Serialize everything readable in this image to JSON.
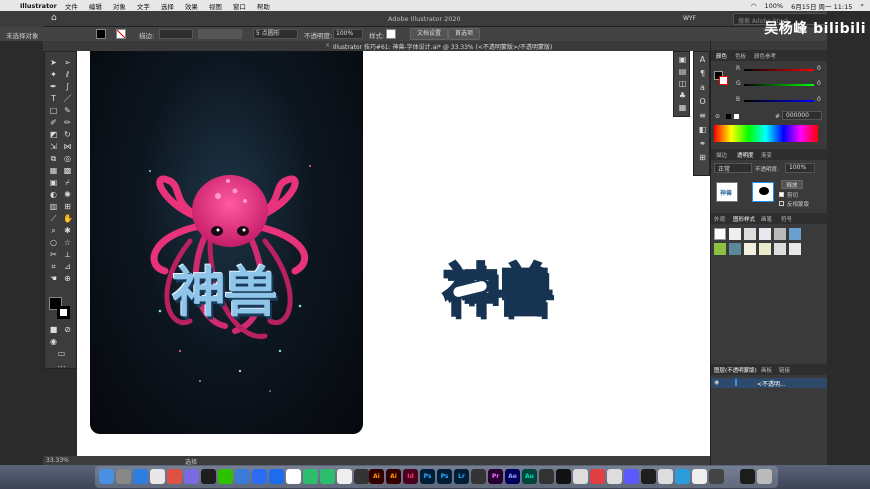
{
  "menubar": {
    "app_name": "Illustrator",
    "items": [
      "文件",
      "编辑",
      "对象",
      "文字",
      "选择",
      "效果",
      "视图",
      "窗口",
      "帮助"
    ],
    "battery": "100%",
    "clock": "6月15日 周一 11:15"
  },
  "appbar": {
    "title": "Adobe Illustrator 2020",
    "workspace": "WYF",
    "stock_placeholder": "搜索 Adobe Stock"
  },
  "controlbar": {
    "selection": "未选择对象",
    "stroke_label": "描边:",
    "brush_size": "5 点圆形",
    "opacity_label": "不透明度:",
    "opacity_value": "100%",
    "style_label": "样式:",
    "doc_setup": "文档设置",
    "preferences": "首选项"
  },
  "document": {
    "tab_title": "Illustrator 技巧#61: 神兽-字体设计.ai* @ 33.33% (<不透明蒙版>/不透明蒙版)"
  },
  "canvas": {
    "artwork_text": "神兽",
    "right_text": "神兽"
  },
  "statusbar": {
    "zoom": "33.33%",
    "tool": "选择"
  },
  "panels": {
    "color_tabs": [
      "颜色",
      "色板",
      "颜色参考"
    ],
    "channels": [
      {
        "label": "R",
        "value": "0"
      },
      {
        "label": "G",
        "value": "0"
      },
      {
        "label": "B",
        "value": "0"
      }
    ],
    "hex": "000000",
    "transparency_tabs": [
      "描边",
      "透明度",
      "渐变"
    ],
    "blend_mode": "正常",
    "opacity_label": "不透明度:",
    "opacity_value": "100%",
    "release_button": "释放",
    "clip_label": "剪切",
    "invert_label": "反相蒙版",
    "style_tabs": [
      "外观",
      "图形样式",
      "画笔",
      "符号"
    ],
    "layers_tabs": [
      "图层(不透明蒙版)",
      "画板",
      "链接"
    ],
    "layer_name": "<不透明..."
  },
  "watermark": {
    "author": "吴杨峰",
    "site": "bilibili"
  },
  "colors": {
    "accent_pink": "#e8337a",
    "text_blue": "#6fa8d4",
    "panel_bg": "#3a3a3a"
  },
  "dock_labels": [
    "Ai",
    "Ai",
    "Id",
    "Ps",
    "Ps",
    "Lr",
    "Pr",
    "Ae",
    "Au"
  ]
}
